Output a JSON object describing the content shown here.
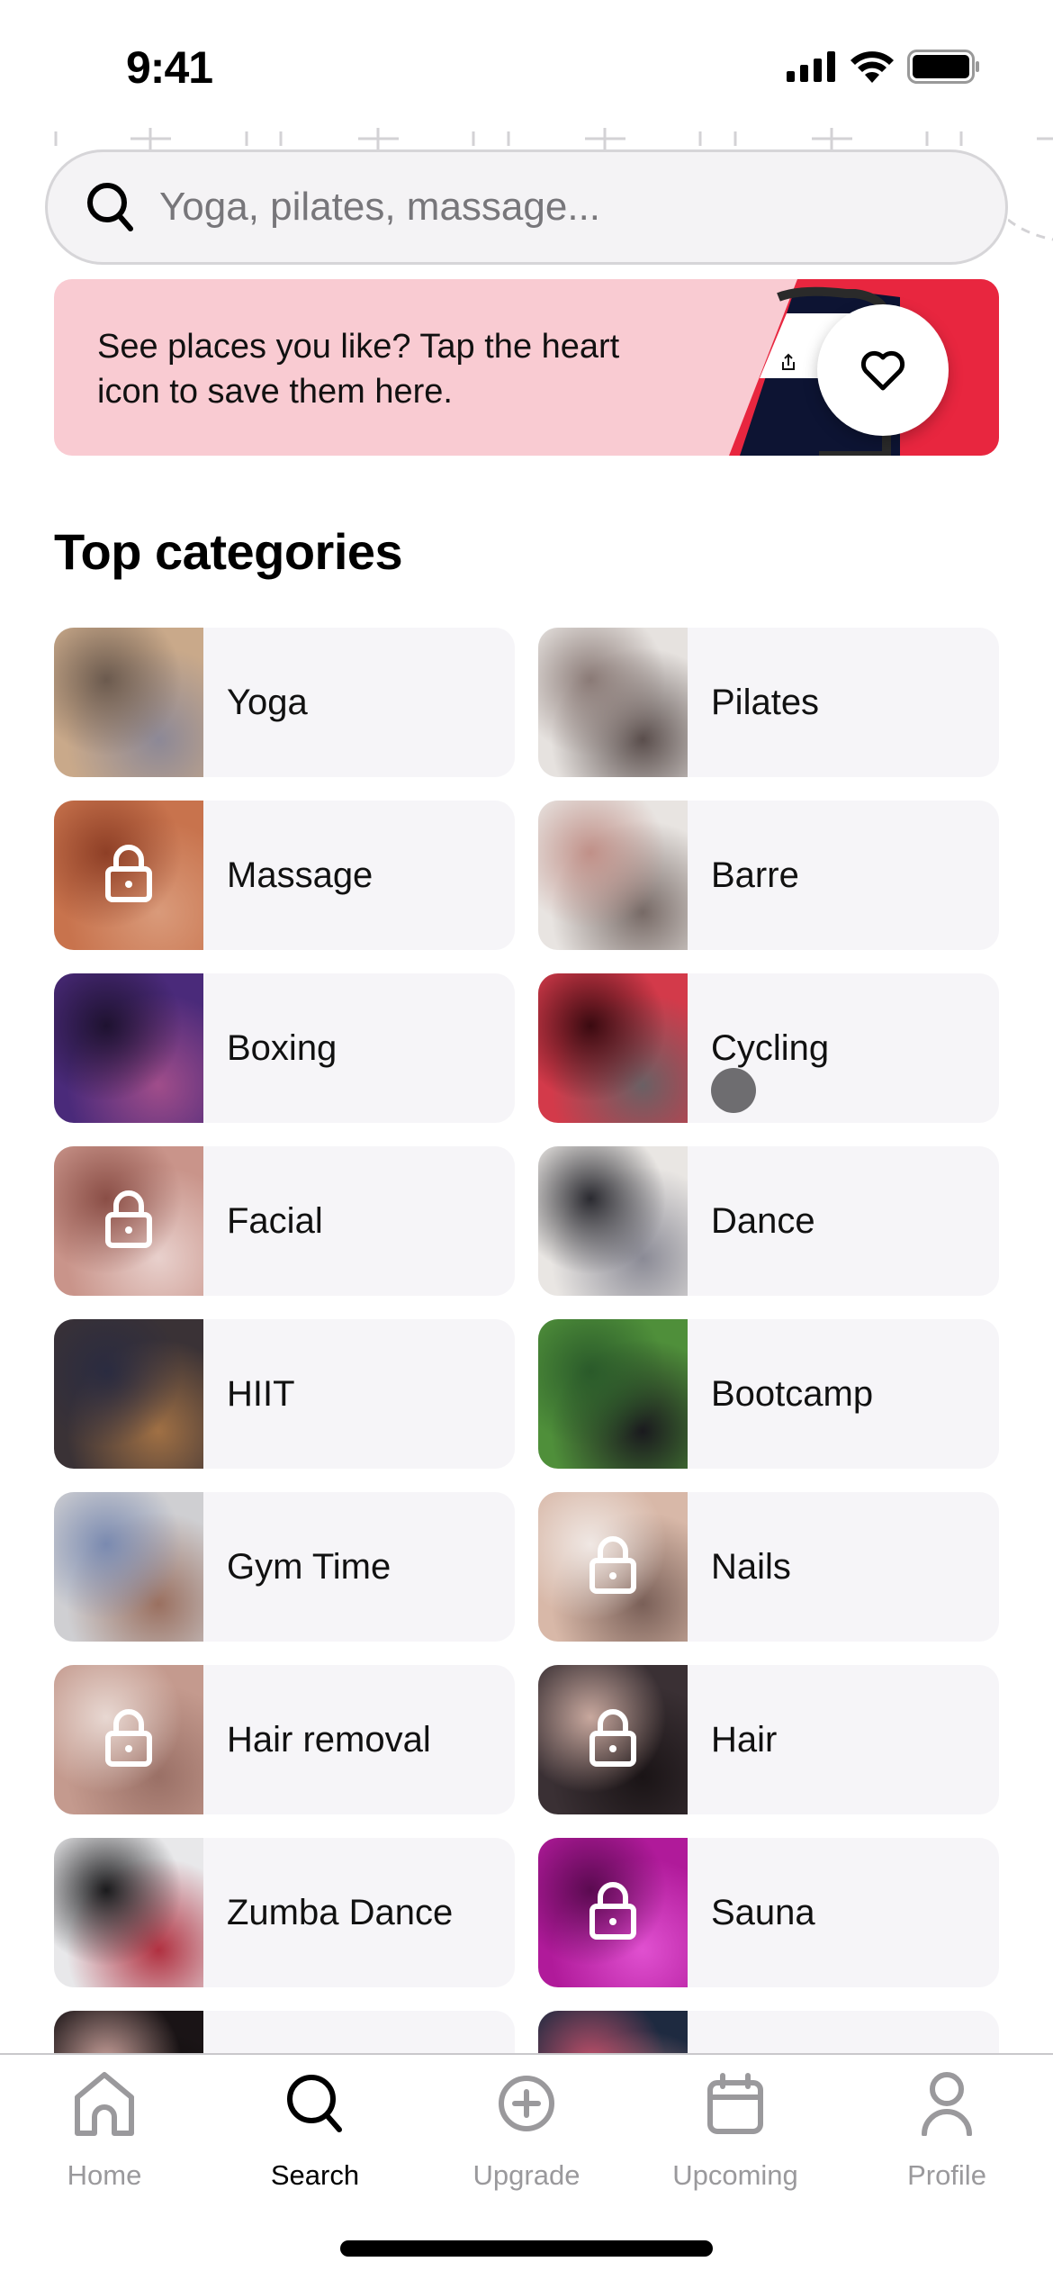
{
  "status_bar": {
    "time": "9:41"
  },
  "search": {
    "placeholder": "Yoga, pilates, massage..."
  },
  "banner": {
    "text": "See places you like? Tap the heart icon to save them here.",
    "icon": "heart-icon",
    "colors": {
      "background": "#f9cbd2",
      "accent": "#e8263f"
    }
  },
  "categories": {
    "title": "Top categories",
    "items": [
      {
        "label": "Yoga",
        "locked": false,
        "colors": [
          "#c9a98a",
          "#6b5a4e",
          "#8c8896"
        ]
      },
      {
        "label": "Pilates",
        "locked": false,
        "colors": [
          "#e6e2df",
          "#8a7a76",
          "#5a4e4c"
        ]
      },
      {
        "label": "Massage",
        "locked": true,
        "colors": [
          "#c8734d",
          "#8e3f26",
          "#d99a7a"
        ]
      },
      {
        "label": "Barre",
        "locked": false,
        "colors": [
          "#e8e4e1",
          "#c09088",
          "#776a66"
        ]
      },
      {
        "label": "Boxing",
        "locked": false,
        "colors": [
          "#4a2a7a",
          "#1e1230",
          "#a04d8a"
        ]
      },
      {
        "label": "Cycling",
        "locked": false,
        "colors": [
          "#d33a4a",
          "#3a0a10",
          "#6a6064"
        ]
      },
      {
        "label": "Facial",
        "locked": true,
        "colors": [
          "#c9948a",
          "#8a4e46",
          "#e8d0cc"
        ]
      },
      {
        "label": "Dance",
        "locked": false,
        "colors": [
          "#e9e6e3",
          "#2a2a30",
          "#8a8a95"
        ]
      },
      {
        "label": "HIIT",
        "locked": false,
        "colors": [
          "#3a3236",
          "#2a2b40",
          "#a07044"
        ]
      },
      {
        "label": "Bootcamp",
        "locked": false,
        "colors": [
          "#4f8f3a",
          "#2a5a2a",
          "#1a1a1e"
        ]
      },
      {
        "label": "Gym Time",
        "locked": false,
        "colors": [
          "#cfcfd2",
          "#7a8ab0",
          "#9a7060"
        ]
      },
      {
        "label": "Nails",
        "locked": true,
        "colors": [
          "#d8b8a8",
          "#f0e8e4",
          "#7a6058"
        ]
      },
      {
        "label": "Hair removal",
        "locked": true,
        "colors": [
          "#c49a8e",
          "#e8d8d2",
          "#9a7066"
        ]
      },
      {
        "label": "Hair",
        "locked": true,
        "colors": [
          "#3a3034",
          "#c8a89e",
          "#1a1416"
        ]
      },
      {
        "label": "Zumba Dance",
        "locked": false,
        "colors": [
          "#e8e8ea",
          "#1a1a1c",
          "#b03040"
        ]
      },
      {
        "label": "Sauna",
        "locked": true,
        "colors": [
          "#b01a9a",
          "#5a0a50",
          "#e050d0"
        ]
      },
      {
        "label": "",
        "locked": false,
        "colors": [
          "#1a1416",
          "#c8a09a",
          "#0a0808"
        ]
      },
      {
        "label": "",
        "locked": false,
        "colors": [
          "#1e2a40",
          "#c0506a",
          "#d09090"
        ]
      }
    ]
  },
  "tab_bar": {
    "tabs": [
      {
        "label": "Home",
        "icon": "home-icon",
        "active": false
      },
      {
        "label": "Search",
        "icon": "search-icon",
        "active": true
      },
      {
        "label": "Upgrade",
        "icon": "plus-circle-icon",
        "active": false
      },
      {
        "label": "Upcoming",
        "icon": "calendar-icon",
        "active": false
      },
      {
        "label": "Profile",
        "icon": "profile-icon",
        "active": false
      }
    ]
  }
}
